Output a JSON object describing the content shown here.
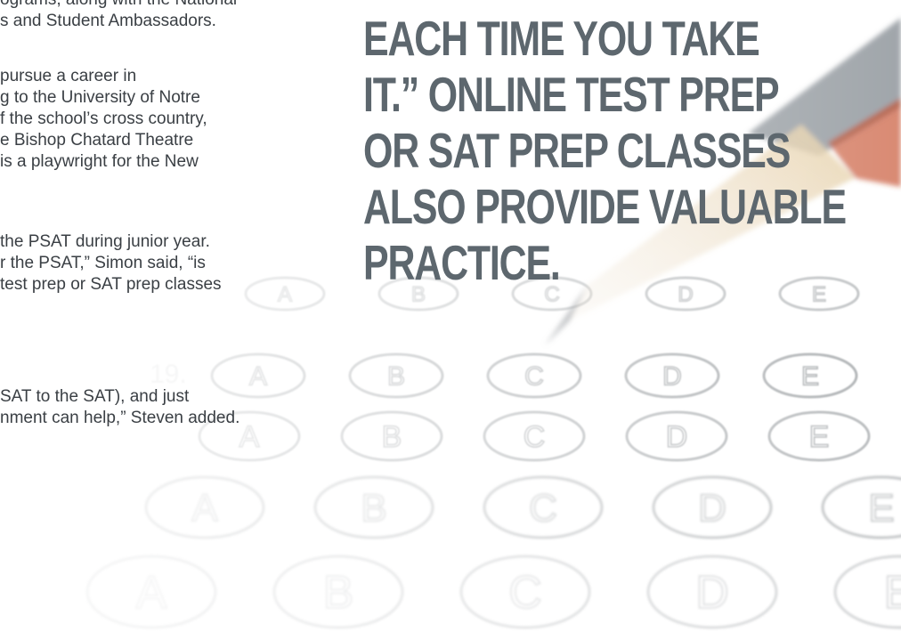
{
  "article": {
    "text_lines": [
      "ograms, along with the National",
      "s and Student Ambassadors.",
      "",
      "pursue a career in",
      "g to the University of Notre",
      "f the school’s cross country,",
      "e Bishop Chatard Theatre",
      "is a playwright for the New",
      "",
      "",
      "the PSAT during junior year.",
      "r the PSAT,” Simon said, “is",
      "test prep or SAT prep classes",
      "",
      "",
      "SAT to the SAT), and just",
      "nment can help,” Steven added."
    ]
  },
  "pull_quote": {
    "lines": [
      "EACH TIME YOU TAKE",
      "IT.” ONLINE TEST PREP",
      "OR SAT PREP CLASSES",
      "ALSO PROVIDE VALUABLE",
      "PRACTICE."
    ],
    "color": "#5d676e"
  },
  "background": {
    "answer_sheet_bubbles": [
      "A",
      "B",
      "C",
      "D",
      "E"
    ],
    "question_number": "19.",
    "pencil_colors": [
      "#d9b98a",
      "#c1441e",
      "#6c7279"
    ]
  }
}
